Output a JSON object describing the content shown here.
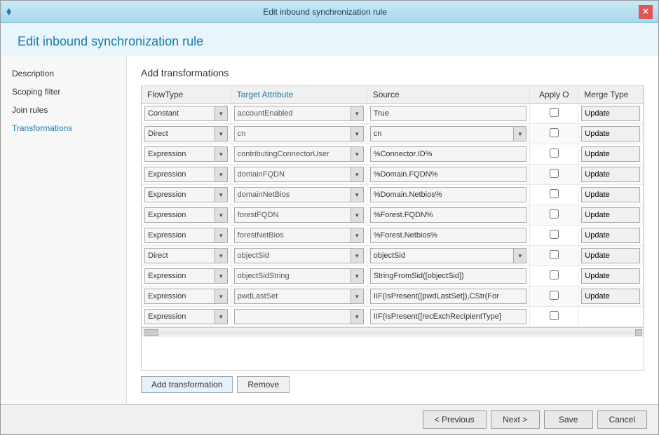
{
  "window": {
    "title": "Edit inbound synchronization rule",
    "close_label": "✕"
  },
  "page_title": "Edit inbound synchronization rule",
  "section_title": "Add transformations",
  "sidebar": {
    "items": [
      {
        "id": "description",
        "label": "Description",
        "active": false
      },
      {
        "id": "scoping-filter",
        "label": "Scoping filter",
        "active": false
      },
      {
        "id": "join-rules",
        "label": "Join rules",
        "active": false
      },
      {
        "id": "transformations",
        "label": "Transformations",
        "active": true
      }
    ]
  },
  "table": {
    "columns": [
      {
        "id": "flowtype",
        "label": "FlowType",
        "blue": false
      },
      {
        "id": "target",
        "label": "Target Attribute",
        "blue": true
      },
      {
        "id": "source",
        "label": "Source",
        "blue": false
      },
      {
        "id": "apply",
        "label": "Apply O",
        "blue": false
      },
      {
        "id": "merge",
        "label": "Merge Type",
        "blue": false
      }
    ],
    "rows": [
      {
        "flowtype": "Constant",
        "target": "accountEnabled",
        "source": "True",
        "source_dropdown": false,
        "apply": false,
        "merge": "Update"
      },
      {
        "flowtype": "Direct",
        "target": "cn",
        "source": "cn",
        "source_dropdown": true,
        "apply": false,
        "merge": "Update"
      },
      {
        "flowtype": "Expression",
        "target": "contributingConnectorUser",
        "source": "%Connector.ID%",
        "source_dropdown": false,
        "apply": false,
        "merge": "Update"
      },
      {
        "flowtype": "Expression",
        "target": "domainFQDN",
        "source": "%Domain.FQDN%",
        "source_dropdown": false,
        "apply": false,
        "merge": "Update"
      },
      {
        "flowtype": "Expression",
        "target": "domainNetBios",
        "source": "%Domain.Netbios%",
        "source_dropdown": false,
        "apply": false,
        "merge": "Update"
      },
      {
        "flowtype": "Expression",
        "target": "forestFQDN",
        "source": "%Forest.FQDN%",
        "source_dropdown": false,
        "apply": false,
        "merge": "Update"
      },
      {
        "flowtype": "Expression",
        "target": "forestNetBios",
        "source": "%Forest.Netbios%",
        "source_dropdown": false,
        "apply": false,
        "merge": "Update"
      },
      {
        "flowtype": "Direct",
        "target": "objectSid",
        "source": "objectSid",
        "source_dropdown": true,
        "apply": false,
        "merge": "Update"
      },
      {
        "flowtype": "Expression",
        "target": "objectSidString",
        "source": "StringFromSid([objectSid])",
        "source_dropdown": false,
        "apply": false,
        "merge": "Update"
      },
      {
        "flowtype": "Expression",
        "target": "pwdLastSet",
        "source": "IIF(IsPresent([pwdLastSet]),CStr(For",
        "source_dropdown": false,
        "apply": false,
        "merge": "Update"
      },
      {
        "flowtype": "Expression",
        "target": "",
        "source": "IIF(IsPresent([recExchRecipientType]",
        "source_dropdown": false,
        "apply": false,
        "merge": ""
      }
    ]
  },
  "buttons": {
    "add_transformation": "Add transformation",
    "remove": "Remove"
  },
  "nav": {
    "previous": "< Previous",
    "next": "Next >",
    "save": "Save",
    "cancel": "Cancel"
  }
}
